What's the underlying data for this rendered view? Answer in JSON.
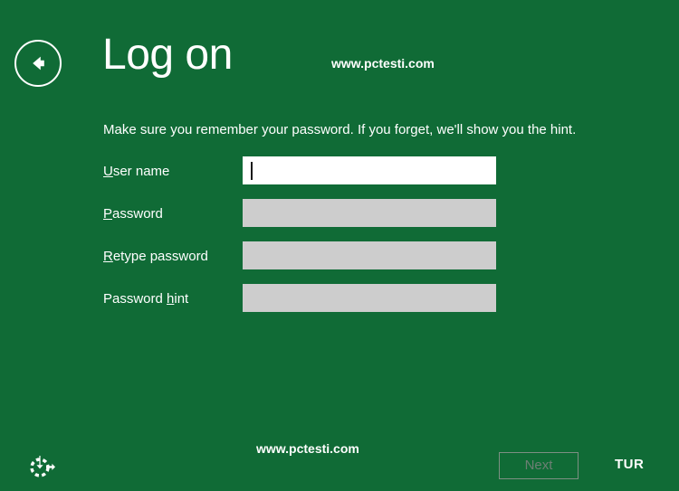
{
  "theme": {
    "background_color": "#106B36",
    "text_color": "#FFFFFF",
    "input_disabled_color": "#CDCDCD",
    "input_focused_color": "#FFFFFF",
    "disabled_button_text_color": "#6D7F74",
    "disabled_button_border_color": "#7D8F83"
  },
  "header": {
    "back_button_icon": "back-arrow-icon",
    "title": "Log on",
    "watermark": "www.pctesti.com"
  },
  "main": {
    "instruction": "Make sure you remember your password. If you forget, we'll show you the hint.",
    "fields": [
      {
        "label_prefix": "",
        "label_accelerator": "U",
        "label_suffix": "ser name",
        "value": "",
        "placeholder": "",
        "state": "focused",
        "type": "text",
        "name": "user-name"
      },
      {
        "label_prefix": "",
        "label_accelerator": "P",
        "label_suffix": "assword",
        "value": "",
        "placeholder": "",
        "state": "disabled",
        "type": "password",
        "name": "password"
      },
      {
        "label_prefix": "",
        "label_accelerator": "R",
        "label_suffix": "etype password",
        "value": "",
        "placeholder": "",
        "state": "disabled",
        "type": "password",
        "name": "retype-password"
      },
      {
        "label_prefix": "Password ",
        "label_accelerator": "h",
        "label_suffix": "int",
        "value": "",
        "placeholder": "",
        "state": "disabled",
        "type": "text",
        "name": "password-hint"
      }
    ]
  },
  "footer": {
    "ease_of_access_icon": "ease-of-access-icon",
    "watermark": "www.pctesti.com",
    "next_label": "Next",
    "next_enabled": false,
    "keyboard_layout": "TUR"
  }
}
